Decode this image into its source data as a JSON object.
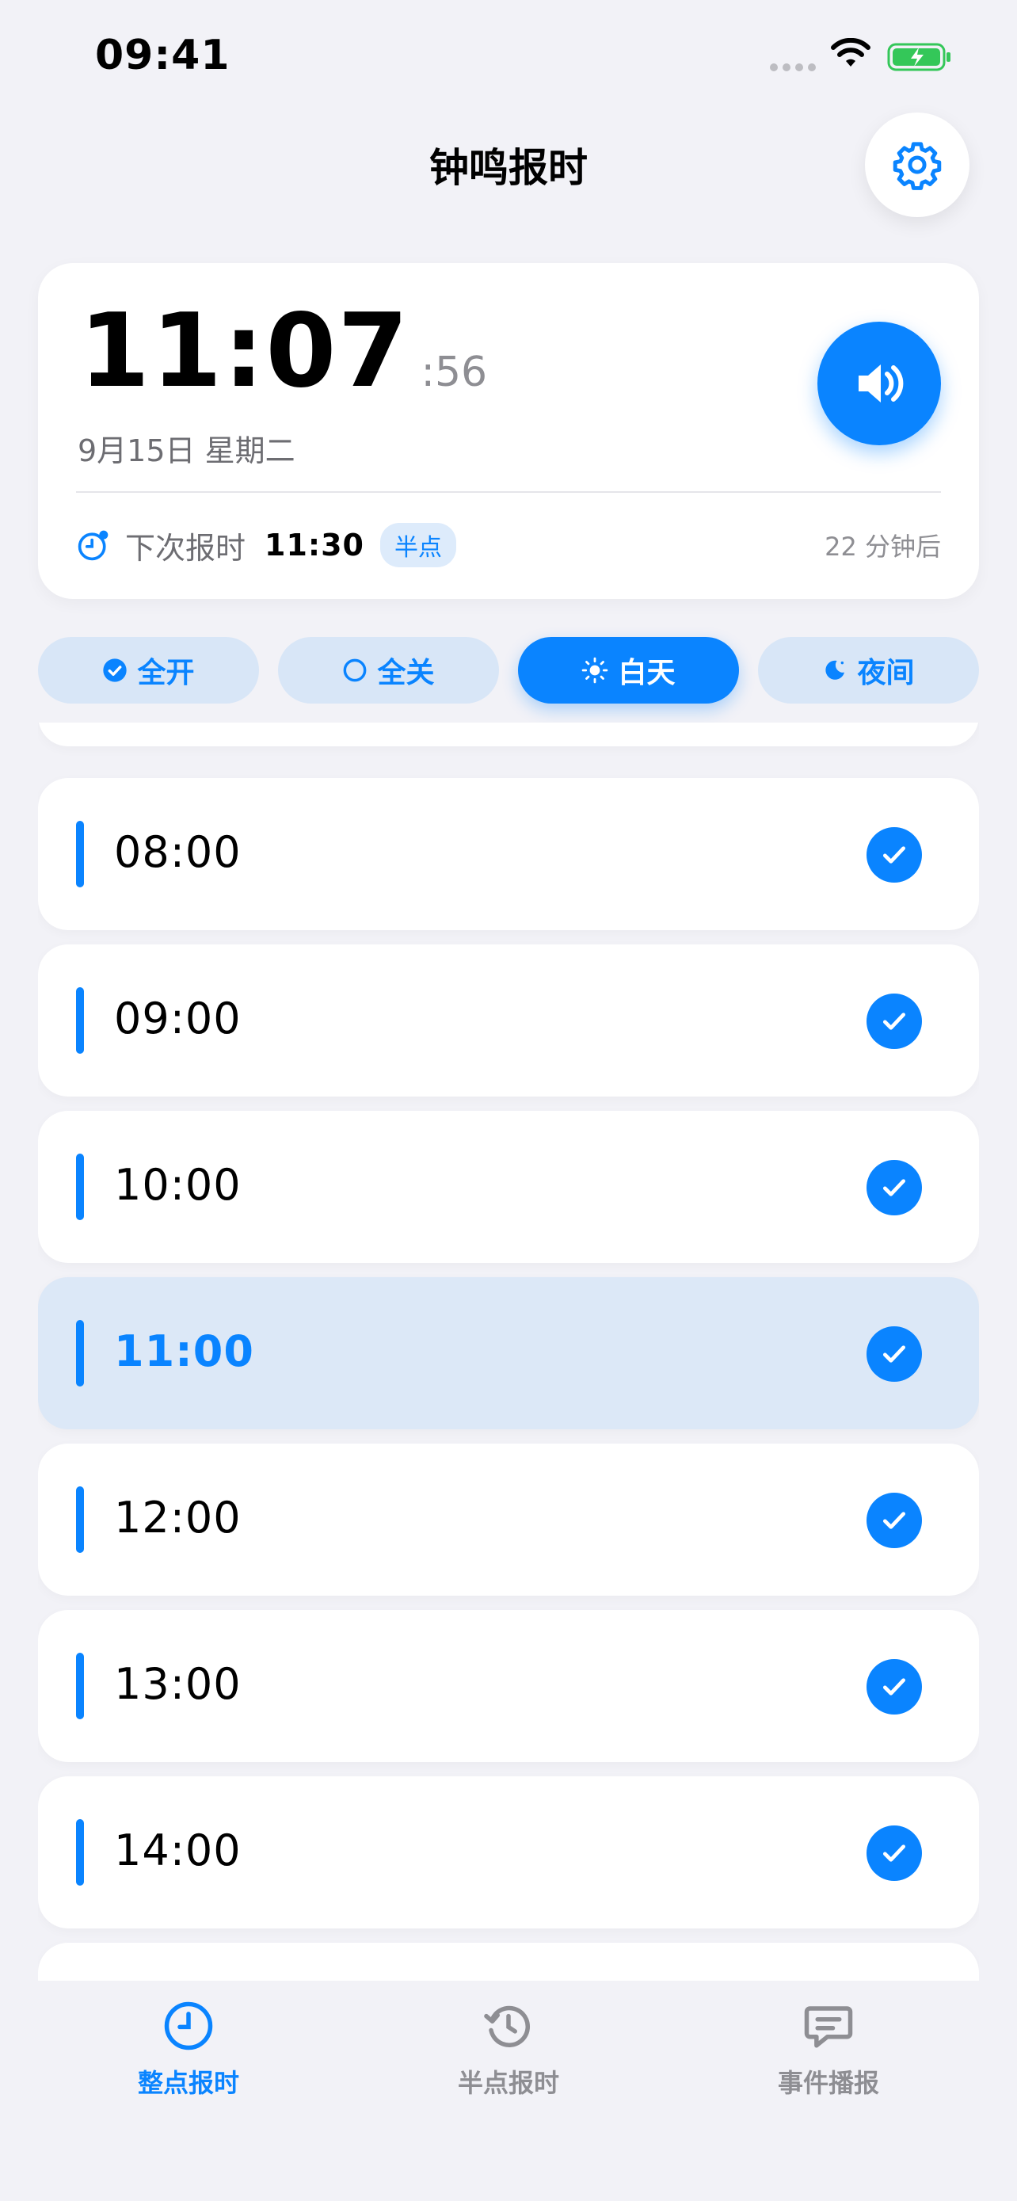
{
  "status_bar": {
    "time": "09:41"
  },
  "header": {
    "title": "钟鸣报时",
    "settings_icon": "gear-icon"
  },
  "clock": {
    "hours_minutes": "11:07",
    "seconds": ":56",
    "date": "9月15日 星期二",
    "next_label": "下次报时",
    "next_time": "11:30",
    "next_badge": "半点",
    "countdown": "22 分钟后"
  },
  "filters": [
    {
      "label": "全开",
      "icon": "check-circle-icon",
      "active": false
    },
    {
      "label": "全关",
      "icon": "circle-icon",
      "active": false
    },
    {
      "label": "白天",
      "icon": "sun-icon",
      "active": true
    },
    {
      "label": "夜间",
      "icon": "moon-icon",
      "active": false
    }
  ],
  "hours": [
    {
      "time": "08:00",
      "checked": true,
      "current": false
    },
    {
      "time": "09:00",
      "checked": true,
      "current": false
    },
    {
      "time": "10:00",
      "checked": true,
      "current": false
    },
    {
      "time": "11:00",
      "checked": true,
      "current": true
    },
    {
      "time": "12:00",
      "checked": true,
      "current": false
    },
    {
      "time": "13:00",
      "checked": true,
      "current": false
    },
    {
      "time": "14:00",
      "checked": true,
      "current": false
    }
  ],
  "tabs": [
    {
      "label": "整点报时",
      "icon": "clock-icon",
      "active": true
    },
    {
      "label": "半点报时",
      "icon": "history-icon",
      "active": false
    },
    {
      "label": "事件播报",
      "icon": "message-icon",
      "active": false
    }
  ],
  "colors": {
    "accent": "#0A84FF",
    "background": "#F2F2F7",
    "highlight": "#DCE8F7"
  }
}
